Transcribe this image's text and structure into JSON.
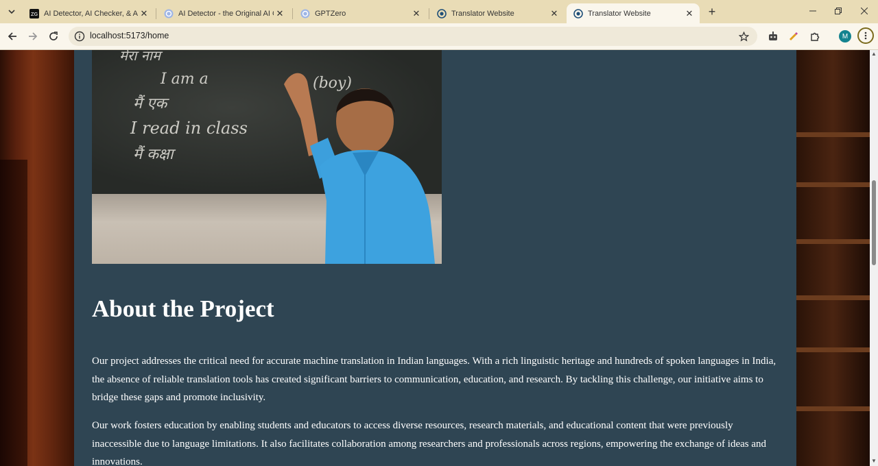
{
  "browser": {
    "tabs": [
      {
        "title": "AI Detector, AI Checker, & AI H",
        "favicon": "zerogpt-icon",
        "active": false
      },
      {
        "title": "AI Detector - the Original AI Ch",
        "favicon": "gptzero-icon",
        "active": false
      },
      {
        "title": "GPTZero",
        "favicon": "gptzero-icon",
        "active": false
      },
      {
        "title": "Translator Website",
        "favicon": "translator-icon",
        "active": false
      },
      {
        "title": "Translator Website",
        "favicon": "translator-icon",
        "active": true
      }
    ],
    "url": "localhost:5173/home",
    "profile_initial": "M"
  },
  "page": {
    "hero_image": {
      "chalk_text": [
        "मेरा नाम",
        "I am a",
        "मैं एक",
        "I read in class",
        "मैं कक्षा",
        "(boy)"
      ]
    },
    "about": {
      "title": "About the Project",
      "paragraphs": [
        "Our project addresses the critical need for accurate machine translation in Indian languages. With a rich linguistic heritage and hundreds of spoken languages in India, the absence of reliable translation tools has created significant barriers to communication, education, and research. By tackling this challenge, our initiative aims to bridge these gaps and promote inclusivity.",
        "Our work fosters education by enabling students and educators to access diverse resources, research materials, and educational content that were previously inaccessible due to language limitations. It also facilitates collaboration among researchers and professionals across regions, empowering the exchange of ideas and innovations."
      ]
    }
  },
  "colors": {
    "tabstrip": "#e9dcb6",
    "toolbar": "#faf6ec",
    "content_bg": "#2f4553",
    "text": "#ffffff"
  }
}
